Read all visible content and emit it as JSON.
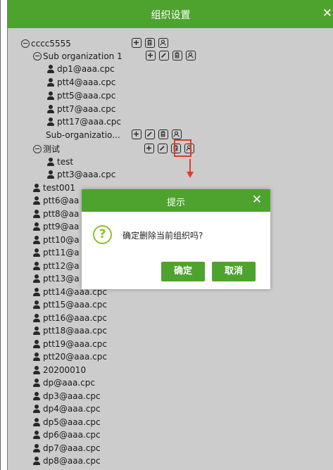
{
  "window": {
    "title": "组织设置",
    "close": "✕"
  },
  "tree": {
    "root": {
      "label": "cccc5555"
    },
    "sub1": {
      "label": "Sub organization 1"
    },
    "sub1_users": [
      "dp1@aaa.cpc",
      "ptt4@aaa.cpc",
      "ptt5@aaa.cpc",
      "ptt7@aaa.cpc",
      "ptt17@aaa.cpc"
    ],
    "sub2": {
      "label": "Sub-organizatio..."
    },
    "sub3": {
      "label": "测试"
    },
    "sub3_users": [
      "test",
      "ptt3@aaa.cpc"
    ],
    "root_users": [
      "test001",
      "ptt6@aa",
      "ptt8@aa",
      "ptt9@aa",
      "ptt10@a",
      "ptt11@a",
      "ptt12@a",
      "ptt13@a",
      "ptt14@aaa.cpc",
      "ptt15@aaa.cpc",
      "ptt16@aaa.cpc",
      "ptt18@aaa.cpc",
      "ptt19@aaa.cpc",
      "ptt20@aaa.cpc",
      "20200010",
      "dp@aaa.cpc",
      "dp3@aaa.cpc",
      "dp4@aaa.cpc",
      "dp5@aaa.cpc",
      "dp6@aaa.cpc",
      "dp7@aaa.cpc",
      "dp8@aaa.cpc"
    ]
  },
  "dialog": {
    "title": "提示",
    "close": "✕",
    "icon_text": "?",
    "message": "确定删除当前组织吗?",
    "ok_label": "确定",
    "cancel_label": "取消"
  },
  "colors": {
    "accent": "#4ea32f",
    "highlight": "#e23a2e",
    "question": "#8ec02a"
  },
  "icons": {
    "add": "plus-square-icon",
    "edit": "pencil-square-icon",
    "delete": "trash-icon",
    "member": "user-square-icon"
  }
}
